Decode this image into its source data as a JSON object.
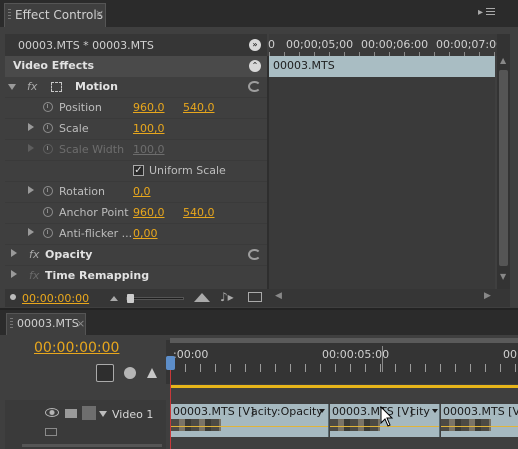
{
  "effect_controls": {
    "tab_title": "Effect Controls",
    "breadcrumb": "00003.MTS * 00003.MTS",
    "section_title": "Video Effects",
    "ruler_labels": [
      "0",
      "00;00;05;00",
      "00:00;06:00",
      "00:00;07:00"
    ],
    "clip_label": "00003.MTS",
    "motion": {
      "label": "Motion",
      "fx": "fx",
      "position": {
        "label": "Position",
        "x": "960,0",
        "y": "540,0"
      },
      "scale": {
        "label": "Scale",
        "value": "100,0"
      },
      "scale_width": {
        "label": "Scale Width",
        "value": "100,0"
      },
      "uniform_scale": {
        "label": "Uniform Scale",
        "checked": true
      },
      "rotation": {
        "label": "Rotation",
        "value": "0,0"
      },
      "anchor_point": {
        "label": "Anchor Point",
        "x": "960,0",
        "y": "540,0"
      },
      "anti_flicker": {
        "label": "Anti-flicker ...",
        "value": "0,00"
      }
    },
    "opacity": {
      "label": "Opacity",
      "fx": "fx"
    },
    "time_remapping": {
      "label": "Time Remapping",
      "fx": "fx"
    },
    "timecode": "00:00:00:00"
  },
  "timeline": {
    "tab_title": "00003.MTS",
    "timecode": "00:00:00:00",
    "ruler_labels": [
      ":00:00",
      "00:00:05:00",
      "00"
    ],
    "track_label": "Video 1",
    "clips": [
      {
        "label": "00003.MTS [V]",
        "extra": "acity:Opacity"
      },
      {
        "label": "00003.MTS [V]",
        "extra": "city"
      },
      {
        "label": "00003.MTS [V]",
        "extra": ""
      }
    ]
  },
  "colors": {
    "accent_yellow": "#e8a71d",
    "clip_blue": "#a6b9c0",
    "playhead_red": "#c7393a"
  }
}
